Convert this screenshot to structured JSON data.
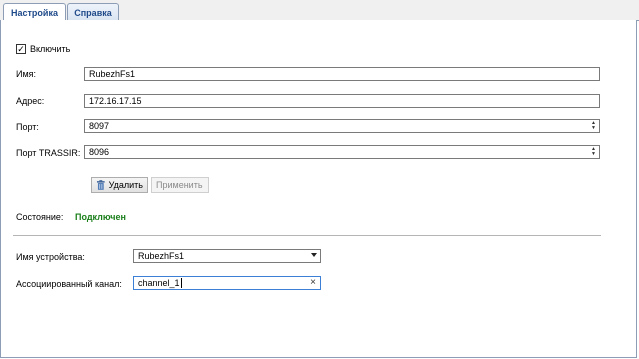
{
  "tabs": [
    {
      "label": "Настройка"
    },
    {
      "label": "Справка"
    }
  ],
  "enable": {
    "label": "Включить",
    "checked": true
  },
  "fields": {
    "name": {
      "label": "Имя:",
      "value": "RubezhFs1"
    },
    "address": {
      "label": "Адрес:",
      "value": "172.16.17.15"
    },
    "port": {
      "label": "Порт:",
      "value": "8097"
    },
    "trassir_port": {
      "label": "Порт TRASSIR:",
      "value": "8096"
    }
  },
  "buttons": {
    "delete": "Удалить",
    "apply": "Применить"
  },
  "status": {
    "label": "Состояние:",
    "value": "Подключен",
    "color": "#1a7f1a"
  },
  "device": {
    "label": "Имя устройства:",
    "value": "RubezhFs1"
  },
  "channel": {
    "label": "Ассоциированный канал:",
    "value": "channel_1"
  },
  "icons": [
    "checkmark-icon",
    "spin-up-icon",
    "spin-down-icon",
    "trash-icon",
    "chevron-down-icon",
    "clear-icon"
  ]
}
